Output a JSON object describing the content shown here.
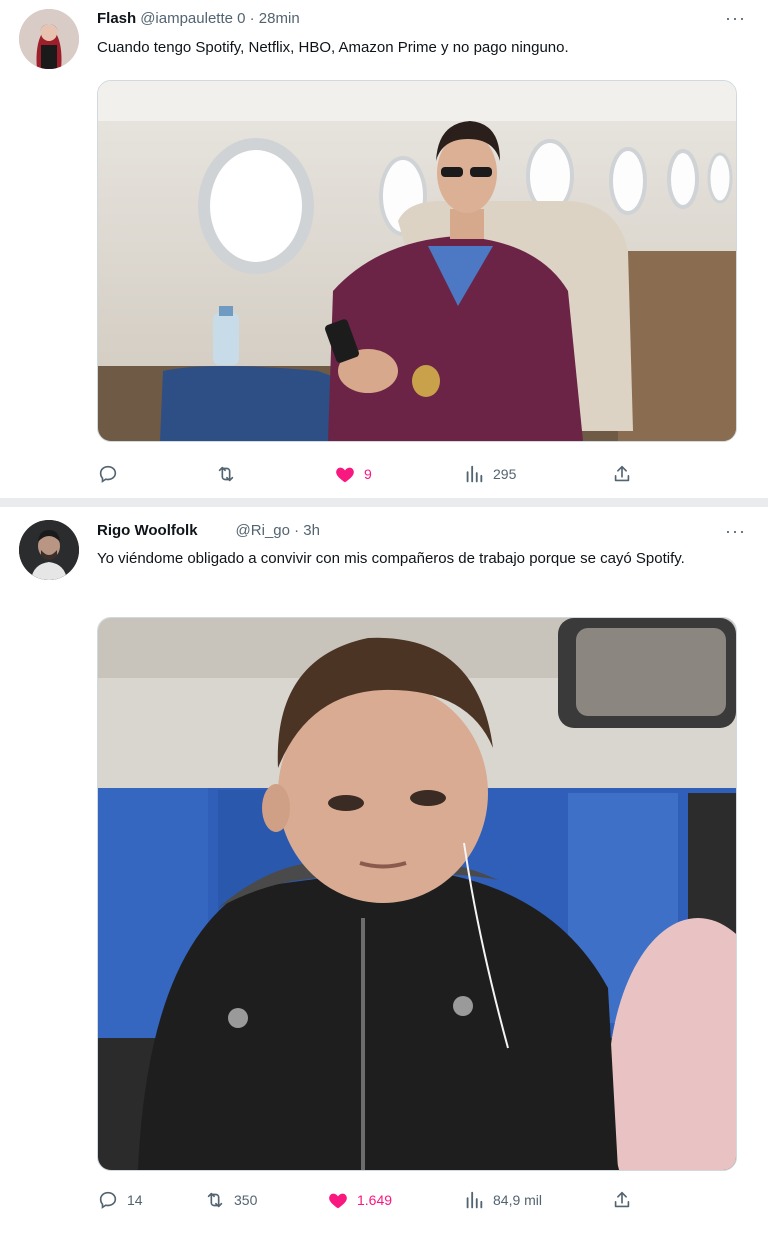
{
  "tweets": [
    {
      "name": "Flash",
      "handle": "@iampaulette 0 · 28min",
      "text": "Cuando tengo Spotify, Netflix, HBO, Amazon Prime y no pago ninguno.",
      "media_alt": "Hombre con saco morado sentado en un avión privado",
      "actions": {
        "replies": "",
        "retweets": "",
        "likes": "9",
        "views": "295"
      },
      "more": "···"
    },
    {
      "name": "Rigo Woolfolk",
      "handle": "@Ri_go · 3h",
      "text": "Yo viéndome obligado a convivir con mis compañeros de trabajo porque se cayó Spotify.",
      "media_alt": "Niño con chaqueta de cuero y audífonos sentado en el metro",
      "actions": {
        "replies": "14",
        "retweets": "350",
        "likes": "1.649",
        "views": "84,9 mil"
      },
      "more": "···"
    }
  ],
  "colors": {
    "like": "#f91880",
    "icon": "#536471",
    "text": "#0f1419",
    "divider": "#e9ebed"
  },
  "icons": [
    "reply-icon",
    "retweet-icon",
    "heart-icon",
    "views-icon",
    "share-icon",
    "more-icon"
  ]
}
